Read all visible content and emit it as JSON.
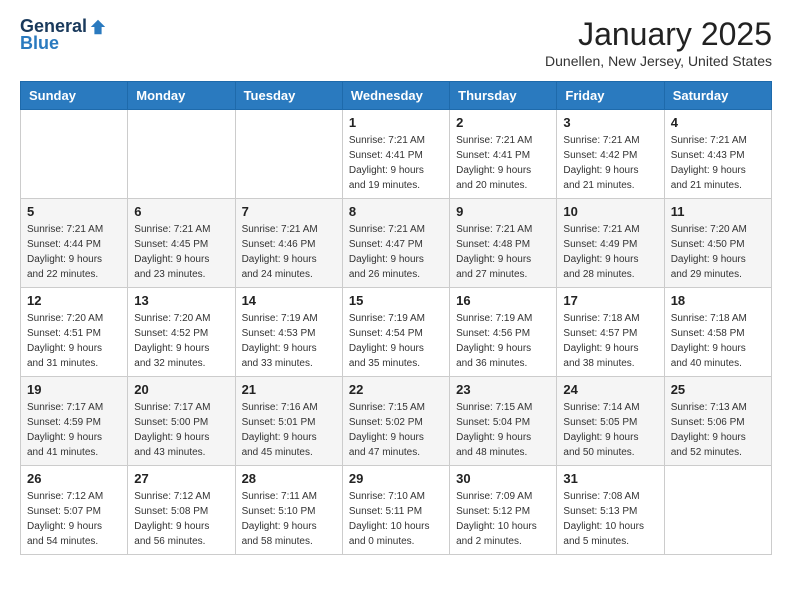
{
  "header": {
    "logo_general": "General",
    "logo_blue": "Blue",
    "month": "January 2025",
    "location": "Dunellen, New Jersey, United States"
  },
  "weekdays": [
    "Sunday",
    "Monday",
    "Tuesday",
    "Wednesday",
    "Thursday",
    "Friday",
    "Saturday"
  ],
  "weeks": [
    [
      {
        "day": "",
        "sunrise": "",
        "sunset": "",
        "daylight": ""
      },
      {
        "day": "",
        "sunrise": "",
        "sunset": "",
        "daylight": ""
      },
      {
        "day": "",
        "sunrise": "",
        "sunset": "",
        "daylight": ""
      },
      {
        "day": "1",
        "sunrise": "Sunrise: 7:21 AM",
        "sunset": "Sunset: 4:41 PM",
        "daylight": "Daylight: 9 hours and 19 minutes."
      },
      {
        "day": "2",
        "sunrise": "Sunrise: 7:21 AM",
        "sunset": "Sunset: 4:41 PM",
        "daylight": "Daylight: 9 hours and 20 minutes."
      },
      {
        "day": "3",
        "sunrise": "Sunrise: 7:21 AM",
        "sunset": "Sunset: 4:42 PM",
        "daylight": "Daylight: 9 hours and 21 minutes."
      },
      {
        "day": "4",
        "sunrise": "Sunrise: 7:21 AM",
        "sunset": "Sunset: 4:43 PM",
        "daylight": "Daylight: 9 hours and 21 minutes."
      }
    ],
    [
      {
        "day": "5",
        "sunrise": "Sunrise: 7:21 AM",
        "sunset": "Sunset: 4:44 PM",
        "daylight": "Daylight: 9 hours and 22 minutes."
      },
      {
        "day": "6",
        "sunrise": "Sunrise: 7:21 AM",
        "sunset": "Sunset: 4:45 PM",
        "daylight": "Daylight: 9 hours and 23 minutes."
      },
      {
        "day": "7",
        "sunrise": "Sunrise: 7:21 AM",
        "sunset": "Sunset: 4:46 PM",
        "daylight": "Daylight: 9 hours and 24 minutes."
      },
      {
        "day": "8",
        "sunrise": "Sunrise: 7:21 AM",
        "sunset": "Sunset: 4:47 PM",
        "daylight": "Daylight: 9 hours and 26 minutes."
      },
      {
        "day": "9",
        "sunrise": "Sunrise: 7:21 AM",
        "sunset": "Sunset: 4:48 PM",
        "daylight": "Daylight: 9 hours and 27 minutes."
      },
      {
        "day": "10",
        "sunrise": "Sunrise: 7:21 AM",
        "sunset": "Sunset: 4:49 PM",
        "daylight": "Daylight: 9 hours and 28 minutes."
      },
      {
        "day": "11",
        "sunrise": "Sunrise: 7:20 AM",
        "sunset": "Sunset: 4:50 PM",
        "daylight": "Daylight: 9 hours and 29 minutes."
      }
    ],
    [
      {
        "day": "12",
        "sunrise": "Sunrise: 7:20 AM",
        "sunset": "Sunset: 4:51 PM",
        "daylight": "Daylight: 9 hours and 31 minutes."
      },
      {
        "day": "13",
        "sunrise": "Sunrise: 7:20 AM",
        "sunset": "Sunset: 4:52 PM",
        "daylight": "Daylight: 9 hours and 32 minutes."
      },
      {
        "day": "14",
        "sunrise": "Sunrise: 7:19 AM",
        "sunset": "Sunset: 4:53 PM",
        "daylight": "Daylight: 9 hours and 33 minutes."
      },
      {
        "day": "15",
        "sunrise": "Sunrise: 7:19 AM",
        "sunset": "Sunset: 4:54 PM",
        "daylight": "Daylight: 9 hours and 35 minutes."
      },
      {
        "day": "16",
        "sunrise": "Sunrise: 7:19 AM",
        "sunset": "Sunset: 4:56 PM",
        "daylight": "Daylight: 9 hours and 36 minutes."
      },
      {
        "day": "17",
        "sunrise": "Sunrise: 7:18 AM",
        "sunset": "Sunset: 4:57 PM",
        "daylight": "Daylight: 9 hours and 38 minutes."
      },
      {
        "day": "18",
        "sunrise": "Sunrise: 7:18 AM",
        "sunset": "Sunset: 4:58 PM",
        "daylight": "Daylight: 9 hours and 40 minutes."
      }
    ],
    [
      {
        "day": "19",
        "sunrise": "Sunrise: 7:17 AM",
        "sunset": "Sunset: 4:59 PM",
        "daylight": "Daylight: 9 hours and 41 minutes."
      },
      {
        "day": "20",
        "sunrise": "Sunrise: 7:17 AM",
        "sunset": "Sunset: 5:00 PM",
        "daylight": "Daylight: 9 hours and 43 minutes."
      },
      {
        "day": "21",
        "sunrise": "Sunrise: 7:16 AM",
        "sunset": "Sunset: 5:01 PM",
        "daylight": "Daylight: 9 hours and 45 minutes."
      },
      {
        "day": "22",
        "sunrise": "Sunrise: 7:15 AM",
        "sunset": "Sunset: 5:02 PM",
        "daylight": "Daylight: 9 hours and 47 minutes."
      },
      {
        "day": "23",
        "sunrise": "Sunrise: 7:15 AM",
        "sunset": "Sunset: 5:04 PM",
        "daylight": "Daylight: 9 hours and 48 minutes."
      },
      {
        "day": "24",
        "sunrise": "Sunrise: 7:14 AM",
        "sunset": "Sunset: 5:05 PM",
        "daylight": "Daylight: 9 hours and 50 minutes."
      },
      {
        "day": "25",
        "sunrise": "Sunrise: 7:13 AM",
        "sunset": "Sunset: 5:06 PM",
        "daylight": "Daylight: 9 hours and 52 minutes."
      }
    ],
    [
      {
        "day": "26",
        "sunrise": "Sunrise: 7:12 AM",
        "sunset": "Sunset: 5:07 PM",
        "daylight": "Daylight: 9 hours and 54 minutes."
      },
      {
        "day": "27",
        "sunrise": "Sunrise: 7:12 AM",
        "sunset": "Sunset: 5:08 PM",
        "daylight": "Daylight: 9 hours and 56 minutes."
      },
      {
        "day": "28",
        "sunrise": "Sunrise: 7:11 AM",
        "sunset": "Sunset: 5:10 PM",
        "daylight": "Daylight: 9 hours and 58 minutes."
      },
      {
        "day": "29",
        "sunrise": "Sunrise: 7:10 AM",
        "sunset": "Sunset: 5:11 PM",
        "daylight": "Daylight: 10 hours and 0 minutes."
      },
      {
        "day": "30",
        "sunrise": "Sunrise: 7:09 AM",
        "sunset": "Sunset: 5:12 PM",
        "daylight": "Daylight: 10 hours and 2 minutes."
      },
      {
        "day": "31",
        "sunrise": "Sunrise: 7:08 AM",
        "sunset": "Sunset: 5:13 PM",
        "daylight": "Daylight: 10 hours and 5 minutes."
      },
      {
        "day": "",
        "sunrise": "",
        "sunset": "",
        "daylight": ""
      }
    ]
  ]
}
